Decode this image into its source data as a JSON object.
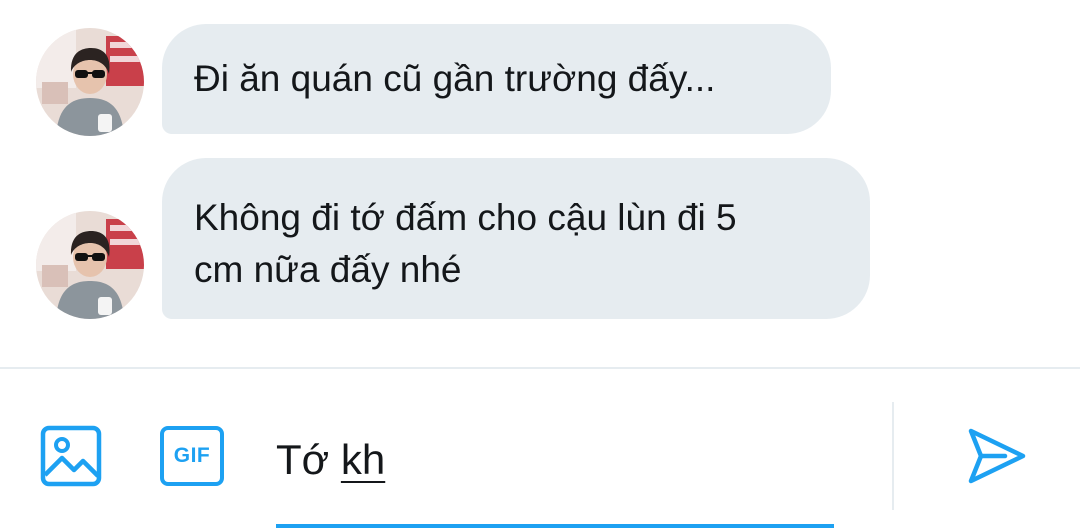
{
  "conversation": {
    "messages": [
      {
        "sender": "other",
        "avatar_icon": "user-avatar",
        "text": "Đi ăn quán cũ gần trường đấy..."
      },
      {
        "sender": "other",
        "avatar_icon": "user-avatar",
        "text": "Không đi tớ đấm cho cậu lùn đi 5\ncm nữa đấy nhé"
      }
    ]
  },
  "composer": {
    "media_icon": "image-icon",
    "gif_label": "GIF",
    "input_text_committed": "Tớ ",
    "input_text_composing": "kh",
    "send_icon": "send-icon"
  },
  "colors": {
    "accent": "#1da1f2",
    "bubble_bg": "#e6ecf0",
    "text": "#14171a"
  }
}
